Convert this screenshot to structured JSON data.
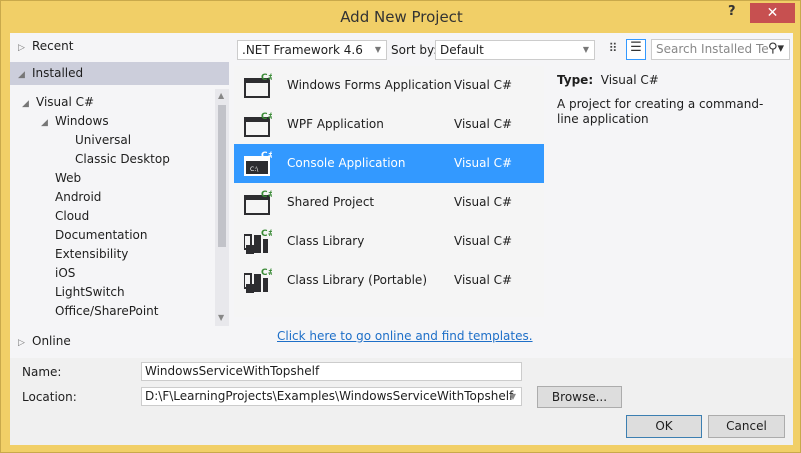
{
  "window": {
    "title": "Add New Project",
    "help": "?",
    "close": "✕"
  },
  "left": {
    "recent": "Recent",
    "installed": "Installed",
    "online": "Online",
    "tree": [
      {
        "label": "Visual C#",
        "level": 0
      },
      {
        "label": "Windows",
        "level": 1
      },
      {
        "label": "Universal",
        "level": 2
      },
      {
        "label": "Classic Desktop",
        "level": 2
      },
      {
        "label": "Web",
        "level": 1
      },
      {
        "label": "Android",
        "level": 1
      },
      {
        "label": "Cloud",
        "level": 1
      },
      {
        "label": "Documentation",
        "level": 1
      },
      {
        "label": "Extensibility",
        "level": 1
      },
      {
        "label": "iOS",
        "level": 1
      },
      {
        "label": "LightSwitch",
        "level": 1
      },
      {
        "label": "Office/SharePoint",
        "level": 1
      }
    ]
  },
  "toolbar": {
    "framework": ".NET Framework 4.6",
    "sort_label": "Sort by:",
    "sort_value": "Default",
    "search_placeholder": "Search Installed Te"
  },
  "templates": [
    {
      "name": "Windows Forms Application",
      "type": "Visual C#",
      "icon": "winforms-icon"
    },
    {
      "name": "WPF Application",
      "type": "Visual C#",
      "icon": "wpf-icon"
    },
    {
      "name": "Console Application",
      "type": "Visual C#",
      "icon": "console-icon",
      "selected": true
    },
    {
      "name": "Shared Project",
      "type": "Visual C#",
      "icon": "shared-project-icon"
    },
    {
      "name": "Class Library",
      "type": "Visual C#",
      "icon": "class-library-icon"
    },
    {
      "name": "Class Library (Portable)",
      "type": "Visual C#",
      "icon": "class-library-portable-icon"
    }
  ],
  "online_link": "Click here to go online and find templates.",
  "details": {
    "type_label": "Type:",
    "type_value": "Visual C#",
    "description": "A project for creating a command-line application"
  },
  "form": {
    "name_label": "Name:",
    "name_value": "WindowsServiceWithTopshelf",
    "location_label": "Location:",
    "location_value": "D:\\F\\LearningProjects\\Examples\\WindowsServiceWithTopshelf",
    "browse": "Browse...",
    "ok": "OK",
    "cancel": "Cancel"
  },
  "colors": {
    "frame": "#f1cf67",
    "selection": "#3399ff",
    "close": "#c75050"
  }
}
